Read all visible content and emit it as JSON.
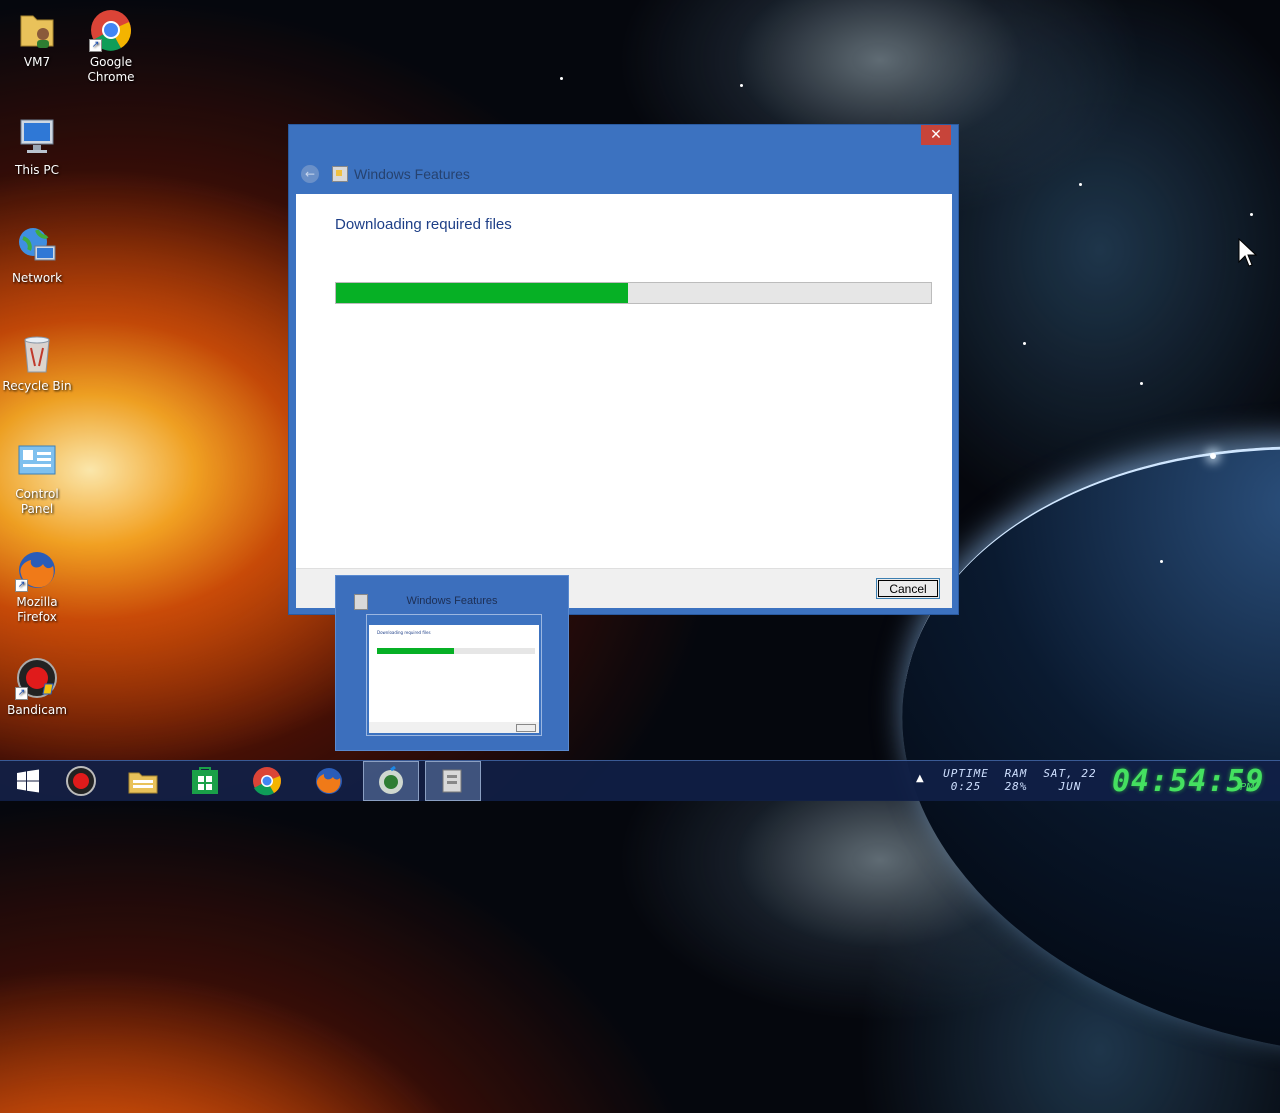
{
  "desktop": {
    "icons": [
      {
        "label": "VM7",
        "icon": "user-folder-icon"
      },
      {
        "label": "Google Chrome",
        "icon": "chrome-icon"
      },
      {
        "label": "This PC",
        "icon": "computer-icon"
      },
      {
        "label": "Network",
        "icon": "network-icon"
      },
      {
        "label": "Recycle Bin",
        "icon": "recycle-bin-icon"
      },
      {
        "label": "Control Panel",
        "icon": "control-panel-icon"
      },
      {
        "label": "Mozilla Firefox",
        "icon": "firefox-icon"
      },
      {
        "label": "Bandicam",
        "icon": "bandicam-icon"
      }
    ]
  },
  "dialog": {
    "title": "Windows Features",
    "close_symbol": "✕",
    "back_symbol": "←",
    "heading": "Downloading required files",
    "progress": 0.49,
    "progress_color": "#06b025",
    "cancel_label": "Cancel"
  },
  "thumbnail": {
    "title": "Windows Features"
  },
  "taskbar": {
    "items": [
      "start",
      "bandicam",
      "file-explorer",
      "store",
      "chrome",
      "firefox",
      "sniffer",
      "windows-features"
    ],
    "tray": {
      "uptime_label": "UPTIME",
      "uptime_value": "0:25",
      "ram_label": "RAM",
      "ram_value": "28%",
      "date_top": "SAT, 22",
      "date_bottom": "JUN",
      "time": "04:54:59",
      "ampm": "PM"
    }
  }
}
